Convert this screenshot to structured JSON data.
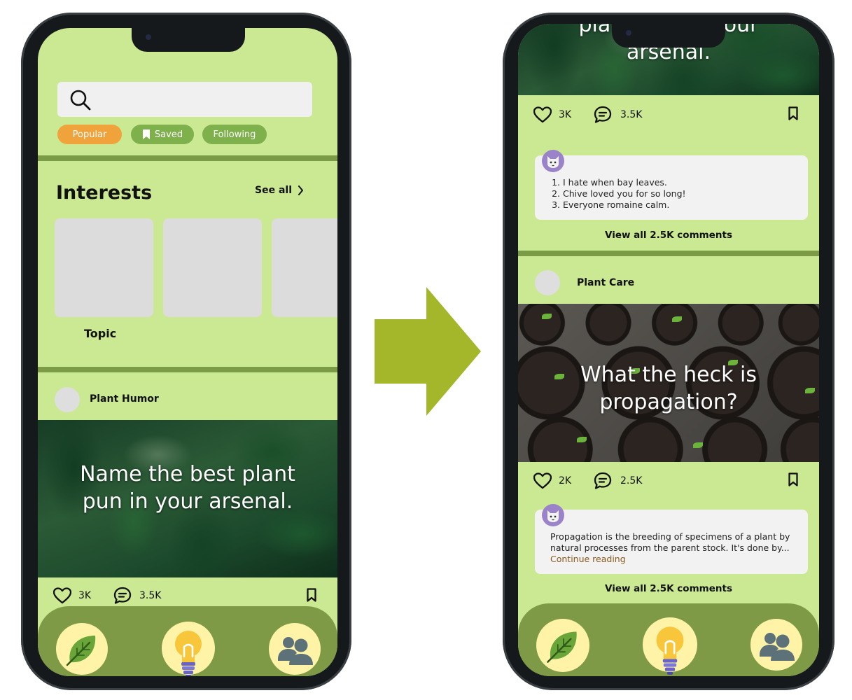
{
  "colors": {
    "screen_bg": "#cbe893",
    "divider": "#7b9b46",
    "chip_popular": "#f0a23b",
    "chip_secondary": "#7eb14c",
    "nav_bar": "#7e9a47",
    "nav_circle": "#fff3a8",
    "arrow": "#a4b62a"
  },
  "left_phone": {
    "filters": {
      "popular": "Popular",
      "saved": "Saved",
      "following": "Following"
    },
    "interests": {
      "title": "Interests",
      "see_all": "See all",
      "topic_label": "Topic"
    },
    "post": {
      "author": "Plant Humor",
      "title": "Name the best plant pun in your arsenal.",
      "likes": "3K",
      "comments": "3.5K"
    }
  },
  "right_phone": {
    "post1": {
      "title_partial": "plant pun in your arsenal.",
      "likes": "3K",
      "comments": "3.5K",
      "comment_lines": [
        "I hate when bay leaves.",
        "Chive loved you for so long!",
        "Everyone romaine calm."
      ],
      "view_all": "View all 2.5K comments"
    },
    "post2": {
      "author": "Plant Care",
      "title": "What the heck is propagation?",
      "likes": "2K",
      "comments": "2.5K",
      "comment_text": "Propagation is the breeding of specimens of a plant by natural processes from the parent stock. It's done by...",
      "continue": "Continue reading",
      "view_all": "View all 2.5K comments"
    }
  },
  "nav": {
    "icons": [
      "leaf-icon",
      "lightbulb-icon",
      "people-icon"
    ]
  }
}
